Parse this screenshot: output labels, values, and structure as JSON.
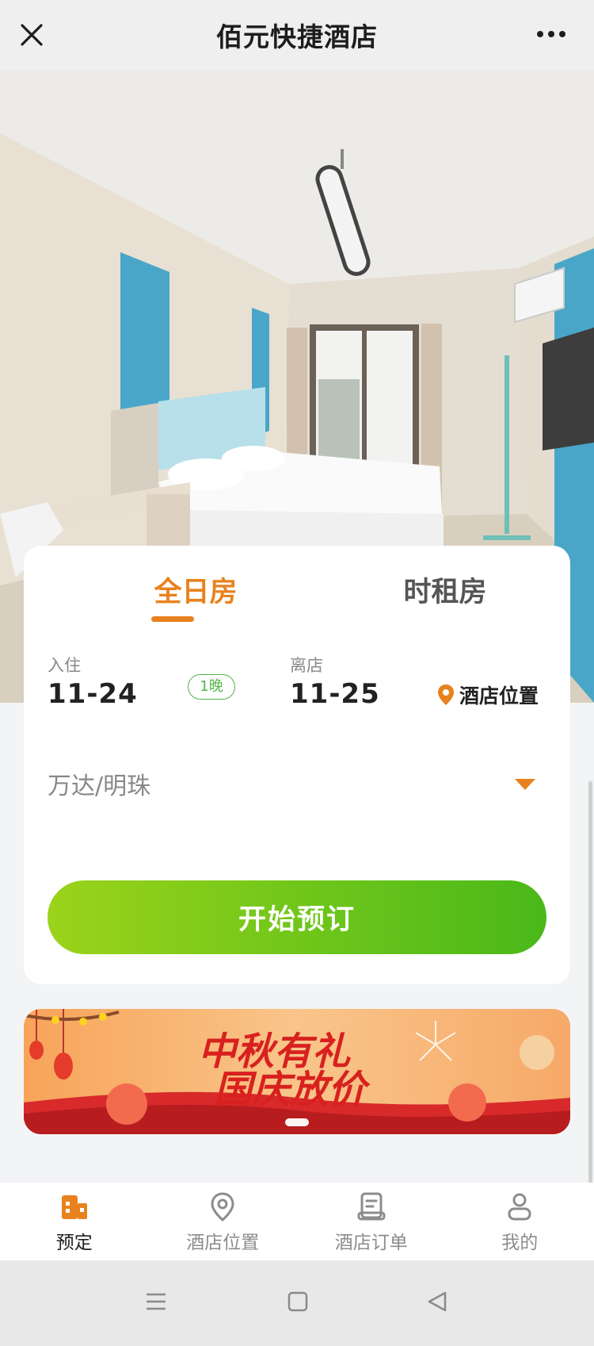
{
  "topbar": {
    "title": "佰元快捷酒店",
    "close_icon": "close-icon",
    "more_icon": "more-dots-icon"
  },
  "hero": {
    "icon": "hotel-room-photo"
  },
  "booking": {
    "tabs": [
      {
        "label": "全日房",
        "active": true
      },
      {
        "label": "时租房",
        "active": false
      }
    ],
    "checkin_label": "入住",
    "checkin_date": "11-24",
    "nights": "1晚",
    "checkout_label": "离店",
    "checkout_date": "11-25",
    "location_link": "酒店位置",
    "district": "万达/明珠",
    "book_button": "开始预订"
  },
  "banner": {
    "text": "中秋有礼 国庆放价",
    "slides": 1
  },
  "bottom_nav": [
    {
      "label": "预定",
      "icon": "building-icon",
      "active": true
    },
    {
      "label": "酒店位置",
      "icon": "location-pin-icon",
      "active": false
    },
    {
      "label": "酒店订单",
      "icon": "order-icon",
      "active": false
    },
    {
      "label": "我的",
      "icon": "person-icon",
      "active": false
    }
  ],
  "colors": {
    "accent": "#e8821e",
    "green": "#52b448",
    "button_start": "#9bd31a",
    "button_end": "#4ab81a"
  }
}
